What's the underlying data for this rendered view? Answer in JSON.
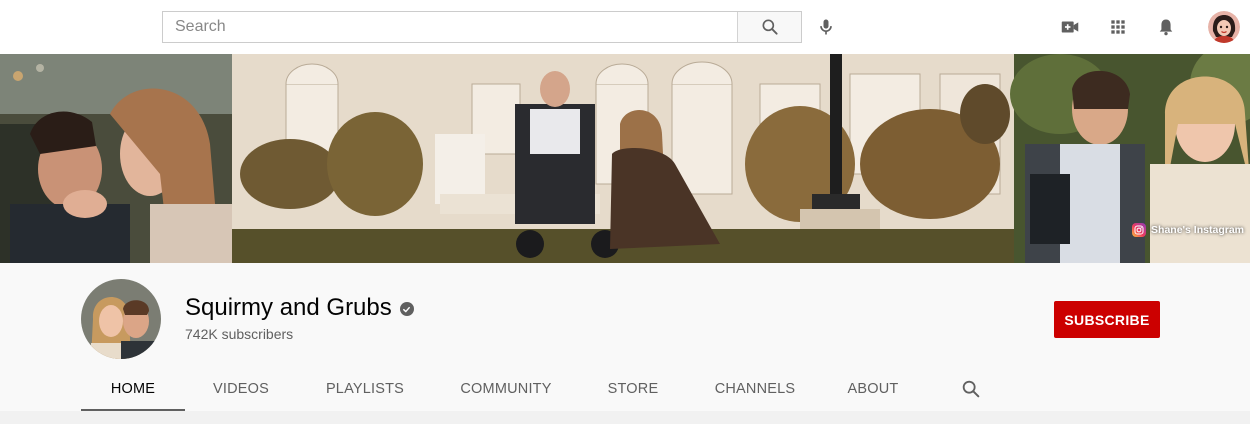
{
  "masthead": {
    "search_placeholder": "Search",
    "icons": {
      "search": "search-icon",
      "mic": "microphone-icon",
      "create": "create-video-icon",
      "apps": "apps-grid-icon",
      "notifications": "bell-icon",
      "account": "account-avatar"
    }
  },
  "banner": {
    "link_label": "Shane's Instagram",
    "link_icon": "instagram-icon"
  },
  "channel": {
    "name": "Squirmy and Grubs",
    "verified_icon": "verified-check-icon",
    "subscribers": "742K subscribers",
    "subscribe_label": "SUBSCRIBE"
  },
  "tabs": [
    {
      "label": "HOME",
      "active": true
    },
    {
      "label": "VIDEOS",
      "active": false
    },
    {
      "label": "PLAYLISTS",
      "active": false
    },
    {
      "label": "COMMUNITY",
      "active": false
    },
    {
      "label": "STORE",
      "active": false
    },
    {
      "label": "CHANNELS",
      "active": false
    },
    {
      "label": "ABOUT",
      "active": false
    }
  ],
  "tab_search_icon": "search-icon",
  "colors": {
    "subscribe": "#cc0000",
    "header_bg": "#f9f9f9",
    "text_primary": "#030303",
    "text_secondary": "#606060"
  }
}
